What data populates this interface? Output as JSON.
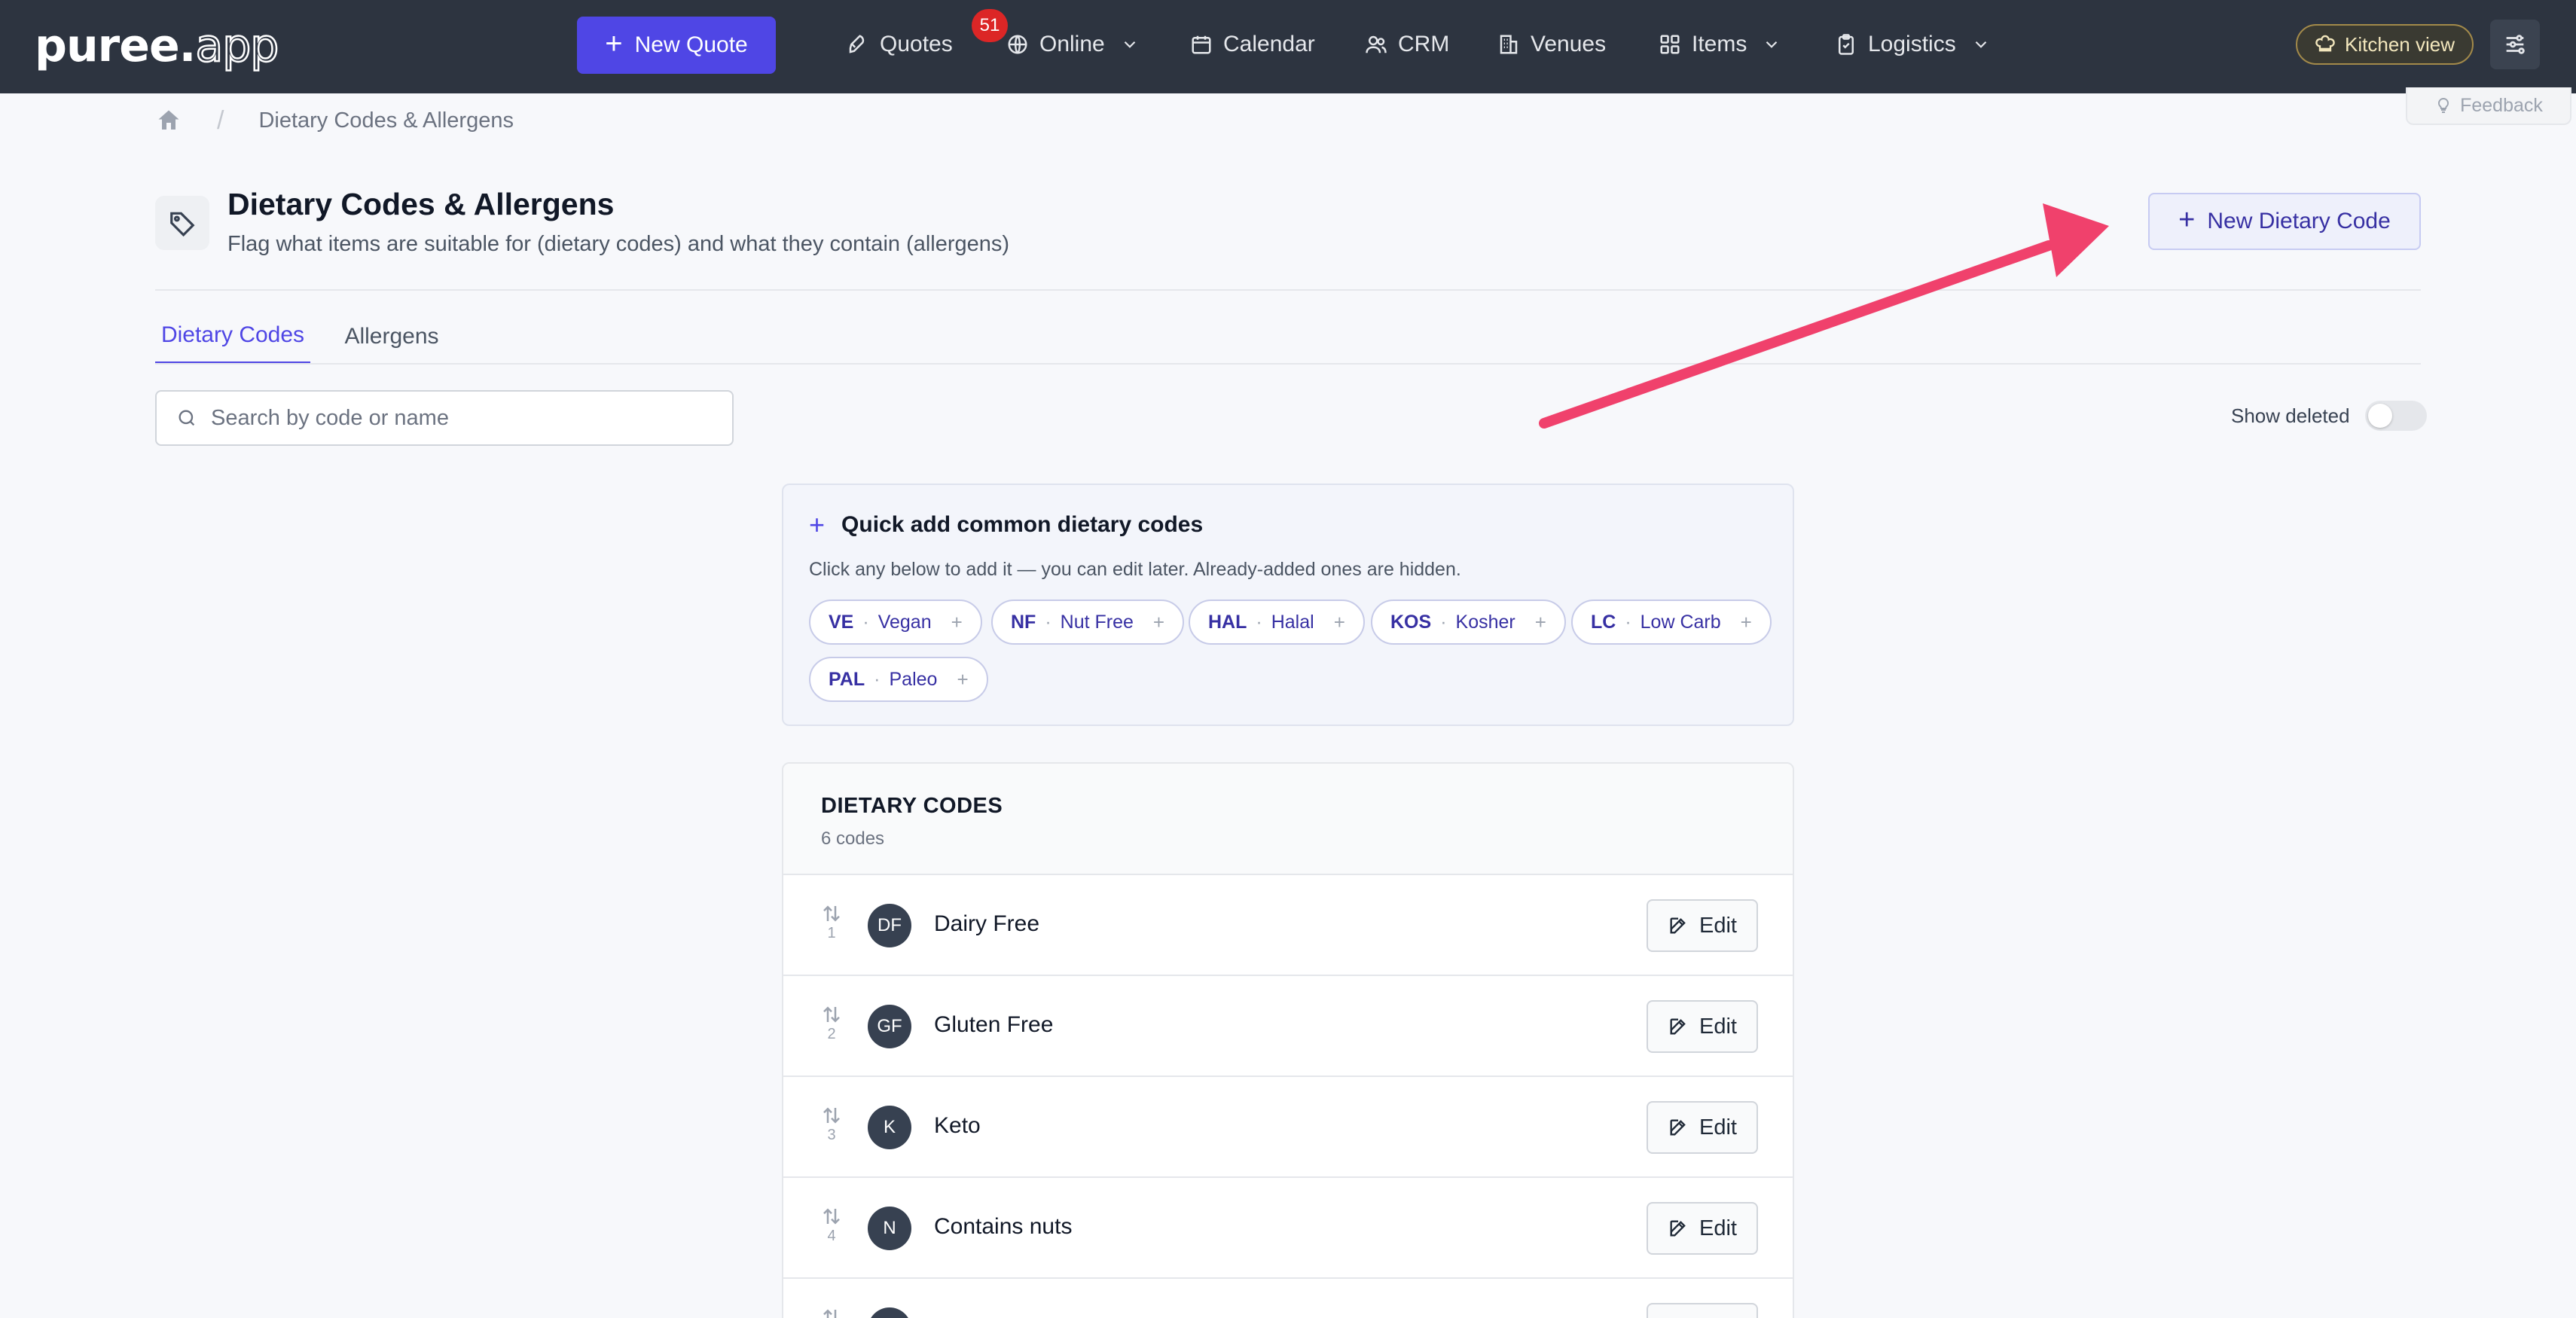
{
  "app": {
    "logo_bold": "puree.",
    "logo_light": "app"
  },
  "nav": {
    "new_quote": "New Quote",
    "quotes": "Quotes",
    "quotes_badge": "51",
    "online": "Online",
    "calendar": "Calendar",
    "crm": "CRM",
    "venues": "Venues",
    "items": "Items",
    "logistics": "Logistics",
    "kitchen_view": "Kitchen view"
  },
  "breadcrumb": {
    "current": "Dietary Codes & Allergens",
    "separator": "/"
  },
  "feedback": "Feedback",
  "header": {
    "title": "Dietary Codes & Allergens",
    "subtitle": "Flag what items are suitable for (dietary codes) and what they contain (allergens)",
    "new_button": "New Dietary Code"
  },
  "tabs": [
    {
      "label": "Dietary Codes",
      "active": true
    },
    {
      "label": "Allergens",
      "active": false
    }
  ],
  "search": {
    "placeholder": "Search by code or name",
    "value": ""
  },
  "show_deleted": {
    "label": "Show deleted",
    "checked": false
  },
  "quick_add": {
    "title": "Quick add common dietary codes",
    "description": "Click any below to add it — you can edit later. Already-added ones are hidden.",
    "chips": [
      {
        "code": "VE",
        "name": "Vegan"
      },
      {
        "code": "NF",
        "name": "Nut Free"
      },
      {
        "code": "HAL",
        "name": "Halal"
      },
      {
        "code": "KOS",
        "name": "Kosher"
      },
      {
        "code": "LC",
        "name": "Low Carb"
      },
      {
        "code": "PAL",
        "name": "Paleo"
      }
    ],
    "chip_separator": "·",
    "chip_plus": "+"
  },
  "codes_card": {
    "title": "DIETARY CODES",
    "count": "6 codes",
    "edit_label": "Edit",
    "rows": [
      {
        "order": "1",
        "code": "DF",
        "name": "Dairy Free"
      },
      {
        "order": "2",
        "code": "GF",
        "name": "Gluten Free"
      },
      {
        "order": "3",
        "code": "K",
        "name": "Keto"
      },
      {
        "order": "4",
        "code": "N",
        "name": "Contains nuts"
      }
    ]
  },
  "colors": {
    "nav_bg": "#2d3440",
    "accent": "#4f46e5",
    "badge": "#dc2626",
    "annotation_arrow": "#f0416c"
  }
}
